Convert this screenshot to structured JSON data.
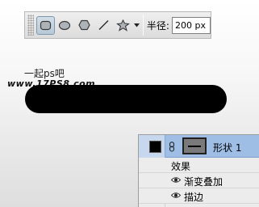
{
  "toolbar": {
    "tools": [
      {
        "name": "rectangle-tool",
        "icon": "rectangle-icon",
        "active": true
      },
      {
        "name": "ellipse-tool",
        "icon": "ellipse-icon",
        "active": false
      },
      {
        "name": "polygon-tool",
        "icon": "polygon-icon",
        "active": false
      },
      {
        "name": "line-tool",
        "icon": "line-icon",
        "active": false
      },
      {
        "name": "custom-shape-tool",
        "icon": "custom-shape-icon",
        "active": false
      }
    ],
    "radius_label": "半径:",
    "radius_value": "200 px"
  },
  "canvas": {
    "watermark_line1": "一起ps吧",
    "watermark_line2": "www.17PS8.com",
    "shape_color": "#000000"
  },
  "layers_panel": {
    "layer_name": "形状 1",
    "swatch_color": "#000000",
    "effects_label": "效果",
    "effects": [
      {
        "label": "渐变叠加",
        "visible": true
      },
      {
        "label": "描边",
        "visible": true
      }
    ]
  }
}
